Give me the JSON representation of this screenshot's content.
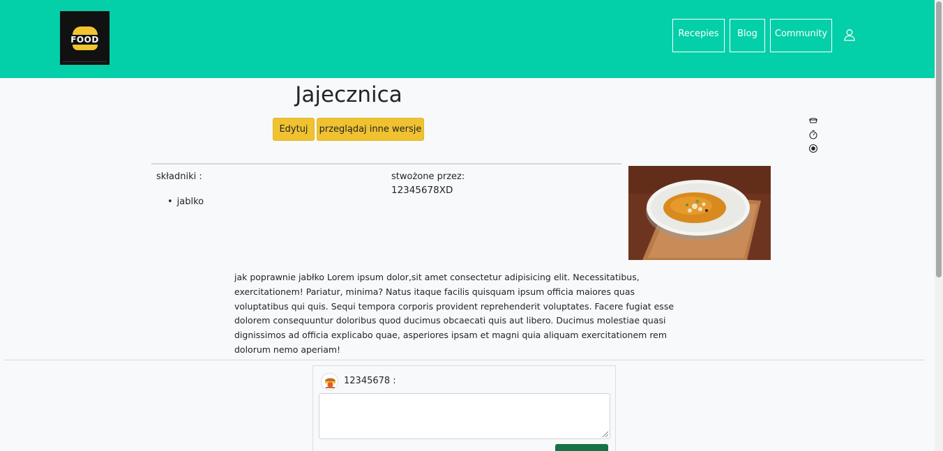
{
  "header": {
    "logo_text": "FOOD",
    "nav": [
      "Recepies",
      "Blog",
      "Community"
    ]
  },
  "recipe": {
    "title": "Jajecznica",
    "edit_label": "Edytuj",
    "versions_label": "przeglądaj inne wersje",
    "ingredients_label": "składniki :",
    "ingredients": [
      "jablko"
    ],
    "created_label": "stwożone przez:",
    "author": "12345678XD",
    "description": "jak poprawnie jabłko Lorem ipsum dolor,sit amet consectetur adipisicing elit. Necessitatibus, exercitationem! Pariatur, minima? Natus itaque facilis quisquam ipsum officia maiores quas voluptatibus qui quis. Sequi tempora corporis provident reprehenderit voluptates. Facere fugiat esse dolorem consequuntur doloribus quod ducimus obcaecati quis aut libero. Ducimus molestiae quasi dignissimos ad officia explicabo quae, asperiores ipsam et magni quia aliquam exercitationem rem dolorum nemo aperiam!"
  },
  "comment": {
    "user": "12345678 :",
    "textarea_value": ""
  },
  "icons": {
    "user": "user-icon",
    "side": [
      "pot-icon",
      "timer-icon",
      "eye-icon"
    ]
  },
  "colors": {
    "navbar": "#03cfa8",
    "accent_button": "#f0c230",
    "submit_button": "#157347"
  }
}
